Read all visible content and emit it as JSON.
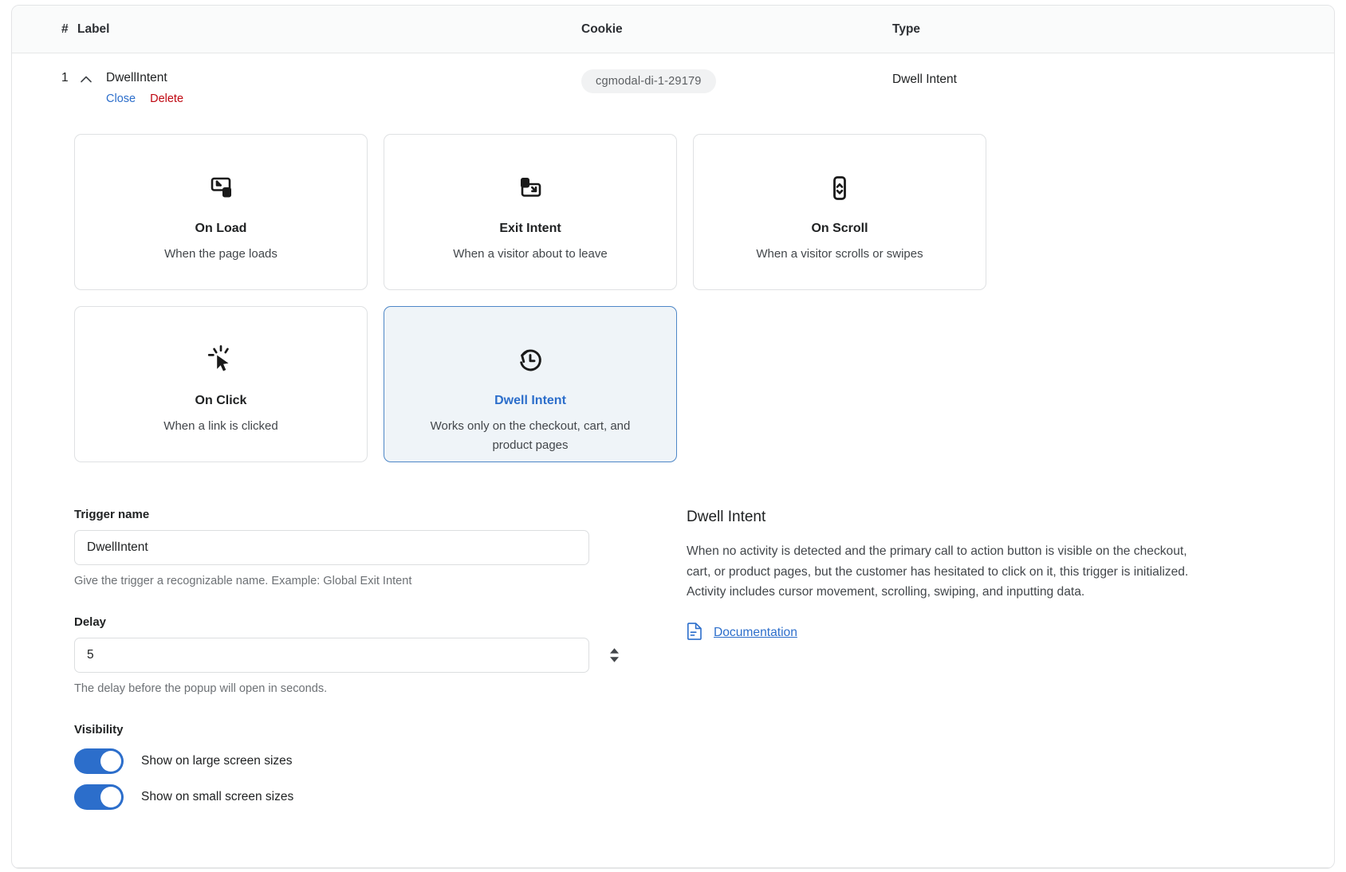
{
  "table": {
    "columns": {
      "number": "#",
      "label": "Label",
      "cookie": "Cookie",
      "type": "Type"
    },
    "row": {
      "number": "1",
      "label": "DwellIntent",
      "close_label": "Close",
      "delete_label": "Delete",
      "cookie": "cgmodal-di-1-29179",
      "type": "Dwell Intent"
    }
  },
  "triggers": [
    {
      "id": "on-load",
      "icon": "on-load-icon",
      "title": "On Load",
      "subtitle": "When the page loads",
      "selected": false
    },
    {
      "id": "exit-intent",
      "icon": "exit-intent-icon",
      "title": "Exit Intent",
      "subtitle": "When a visitor about to leave",
      "selected": false
    },
    {
      "id": "on-scroll",
      "icon": "on-scroll-icon",
      "title": "On Scroll",
      "subtitle": "When a visitor scrolls or swipes",
      "selected": false
    },
    {
      "id": "on-click",
      "icon": "on-click-icon",
      "title": "On Click",
      "subtitle": "When a link is clicked",
      "selected": false
    },
    {
      "id": "dwell-intent",
      "icon": "dwell-intent-icon",
      "title": "Dwell Intent",
      "subtitle": "Works only on the checkout, cart, and product pages",
      "selected": true
    }
  ],
  "form": {
    "trigger_name": {
      "label": "Trigger name",
      "value": "DwellIntent",
      "placeholder": "",
      "help": "Give the trigger a recognizable name. Example: Global Exit Intent"
    },
    "delay": {
      "label": "Delay",
      "value": "5",
      "placeholder": "",
      "help": "The delay before the popup will open in seconds."
    },
    "visibility": {
      "label": "Visibility",
      "toggles": [
        {
          "label": "Show on large screen sizes",
          "on": true
        },
        {
          "label": "Show on small screen sizes",
          "on": true
        }
      ]
    }
  },
  "info_panel": {
    "title": "Dwell Intent",
    "body": "When no activity is detected and the primary call to action button is visible on the checkout, cart, or product pages, but the customer has hesitated to click on it, this trigger is initialized. Activity includes cursor movement, scrolling, swiping, and inputting data.",
    "doc_link": "Documentation"
  },
  "colors": {
    "accent": "#2c6ecb",
    "danger": "#bf0711",
    "selected_bg": "#eff4f8",
    "selected_border": "#4e87c7",
    "pill_bg": "#f1f2f3"
  }
}
